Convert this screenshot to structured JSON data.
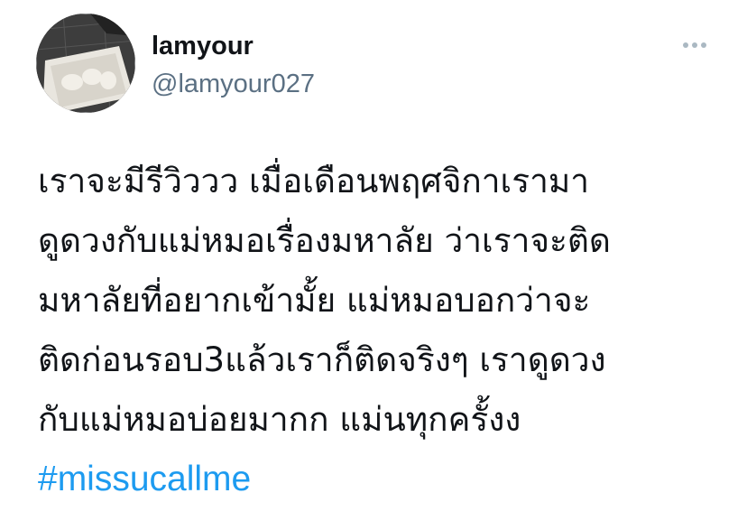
{
  "tweet": {
    "author": {
      "display_name": "lamyour",
      "handle": "@lamyour027",
      "avatar_icon": "avatar-photo-icon"
    },
    "more_icon": "more-horizontal-icon",
    "text_lines": [
      "เราจะมีรีวิววว เมื่อเดือนพฤศจิกาเรามา",
      "ดูดวงกับแม่หมอเรื่องมหาลัย ว่าเราจะติด",
      "มหาลัยที่อยากเข้ามั้ย แม่หมอบอกว่าจะ",
      "ติดก่อนรอบ3แล้วเราก็ติดจริงๆ เราดูดวง",
      "กับแม่หมอบ่อยมากก แม่นทุกครั้งง"
    ],
    "hashtag": "#missucallme"
  },
  "colors": {
    "text": "#111418",
    "secondary": "#5b7083",
    "link": "#1d9bf0",
    "background": "#ffffff"
  }
}
